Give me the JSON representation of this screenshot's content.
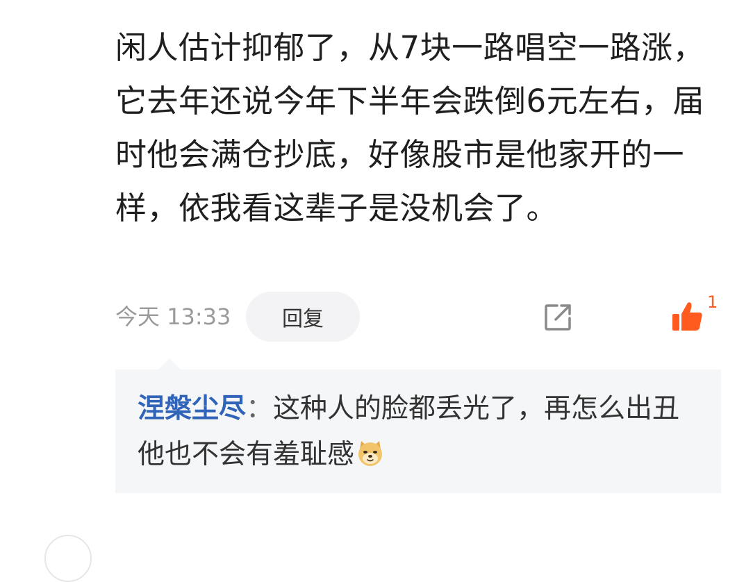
{
  "comment": {
    "top_cutoff_text": "",
    "body": "闲人估计抑郁了，从7块一路唱空一路涨，它去年还说今年下半年会跌倒6元左右，届时他会满仓抄底，好像股市是他家开的一样，依我看这辈子是没机会了。",
    "timestamp": "今天 13:33",
    "reply_label": "回复",
    "like_count": "1",
    "share_icon": "share-external-icon",
    "like_icon": "thumbs-up-icon",
    "accent_color": "#ff5b1f"
  },
  "reply": {
    "author": "涅槃尘尽",
    "separator": "：",
    "text": "这种人的脸都丢光了，再怎么出丑他也不会有羞耻感",
    "emoji": "doge-emoji-icon",
    "author_color": "#2f64b9"
  }
}
